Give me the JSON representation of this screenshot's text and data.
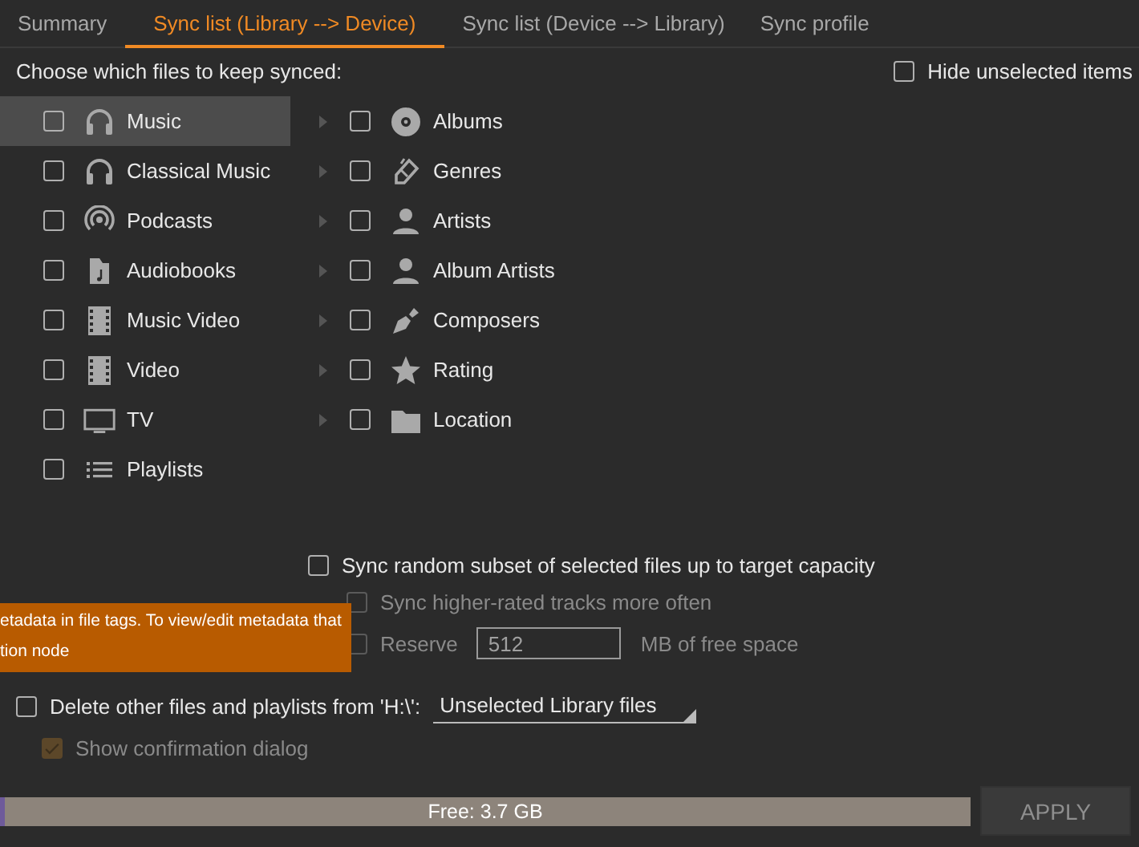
{
  "tabs": [
    {
      "label": "Summary",
      "selected": false
    },
    {
      "label": "Sync list (Library --> Device)",
      "selected": true
    },
    {
      "label": "Sync list (Device --> Library)",
      "selected": false
    },
    {
      "label": "Sync profile",
      "selected": false
    }
  ],
  "prompt": "Choose which files to keep synced:",
  "hide_unselected": {
    "label": "Hide unselected items",
    "checked": false
  },
  "sources": [
    {
      "label": "Music",
      "checked": false,
      "selected": true
    },
    {
      "label": "Classical Music",
      "checked": false,
      "selected": false
    },
    {
      "label": "Podcasts",
      "checked": false,
      "selected": false
    },
    {
      "label": "Audiobooks",
      "checked": false,
      "selected": false
    },
    {
      "label": "Music Video",
      "checked": false,
      "selected": false
    },
    {
      "label": "Video",
      "checked": false,
      "selected": false
    },
    {
      "label": "TV",
      "checked": false,
      "selected": false
    },
    {
      "label": "Playlists",
      "checked": false,
      "selected": false
    }
  ],
  "nodes": [
    {
      "label": "Albums",
      "checked": false,
      "expanded": false
    },
    {
      "label": "Genres",
      "checked": false,
      "expanded": false
    },
    {
      "label": "Artists",
      "checked": false,
      "expanded": false
    },
    {
      "label": "Album Artists",
      "checked": false,
      "expanded": false
    },
    {
      "label": "Composers",
      "checked": false,
      "expanded": false
    },
    {
      "label": "Rating",
      "checked": false,
      "expanded": false
    },
    {
      "label": "Location",
      "checked": false,
      "expanded": false
    }
  ],
  "options": [
    {
      "label": "Sync random subset of selected files up to target capacity",
      "checked": false,
      "disabled": false
    },
    {
      "label": "Sync higher-rated tracks more often",
      "checked": false,
      "disabled": true
    }
  ],
  "reserve": {
    "label": "Reserve",
    "checked": false,
    "disabled": true,
    "value": "512",
    "unit": "MB of free space"
  },
  "tooltip": {
    "lines": [
      "etadata in file tags. To view/edit metadata that",
      "tion node"
    ]
  },
  "delete_option": {
    "label": "Delete other files and playlists from 'H:\\':",
    "checked": false,
    "dropdown": "Unselected Library files"
  },
  "confirm": {
    "label": "Show confirmation dialog",
    "checked": true,
    "disabled": true
  },
  "capacity": {
    "label": "Free: 3.7 GB",
    "level": 0.005
  },
  "apply_button": {
    "label": "APPLY",
    "disabled": true
  }
}
